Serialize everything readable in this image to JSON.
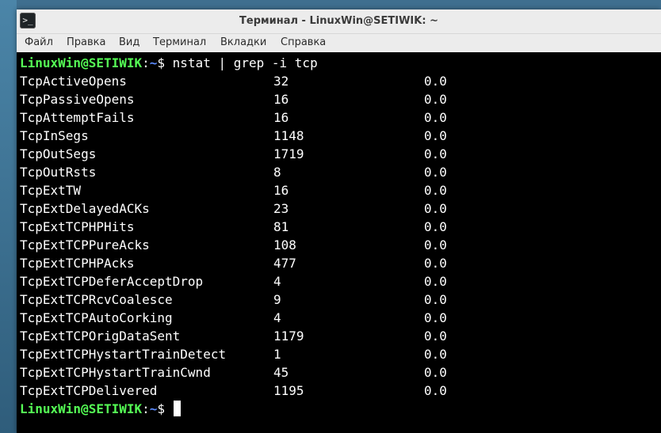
{
  "window": {
    "title": "Терминал - LinuxWin@SETIWIK: ~",
    "icon": "terminal-icon"
  },
  "menu": [
    "Файл",
    "Правка",
    "Вид",
    "Терминал",
    "Вкладки",
    "Справка"
  ],
  "prompt": {
    "user_host": "LinuxWin@SETIWIK",
    "colon": ":",
    "path": "~",
    "dollar": "$ "
  },
  "command": "nstat | grep -i tcp",
  "rows": [
    {
      "name": "TcpActiveOpens",
      "value": "32",
      "rate": "0.0"
    },
    {
      "name": "TcpPassiveOpens",
      "value": "16",
      "rate": "0.0"
    },
    {
      "name": "TcpAttemptFails",
      "value": "16",
      "rate": "0.0"
    },
    {
      "name": "TcpInSegs",
      "value": "1148",
      "rate": "0.0"
    },
    {
      "name": "TcpOutSegs",
      "value": "1719",
      "rate": "0.0"
    },
    {
      "name": "TcpOutRsts",
      "value": "8",
      "rate": "0.0"
    },
    {
      "name": "TcpExtTW",
      "value": "16",
      "rate": "0.0"
    },
    {
      "name": "TcpExtDelayedACKs",
      "value": "23",
      "rate": "0.0"
    },
    {
      "name": "TcpExtTCPHPHits",
      "value": "81",
      "rate": "0.0"
    },
    {
      "name": "TcpExtTCPPureAcks",
      "value": "108",
      "rate": "0.0"
    },
    {
      "name": "TcpExtTCPHPAcks",
      "value": "477",
      "rate": "0.0"
    },
    {
      "name": "TcpExtTCPDeferAcceptDrop",
      "value": "4",
      "rate": "0.0"
    },
    {
      "name": "TcpExtTCPRcvCoalesce",
      "value": "9",
      "rate": "0.0"
    },
    {
      "name": "TcpExtTCPAutoCorking",
      "value": "4",
      "rate": "0.0"
    },
    {
      "name": "TcpExtTCPOrigDataSent",
      "value": "1179",
      "rate": "0.0"
    },
    {
      "name": "TcpExtTCPHystartTrainDetect",
      "value": "1",
      "rate": "0.0"
    },
    {
      "name": "TcpExtTCPHystartTrainCwnd",
      "value": "45",
      "rate": "0.0"
    },
    {
      "name": "TcpExtTCPDelivered",
      "value": "1195",
      "rate": "0.0"
    }
  ],
  "colors": {
    "prompt_user": "#55ff55",
    "prompt_path": "#5c8cff",
    "terminal_bg": "#000000",
    "terminal_fg": "#ffffff"
  }
}
